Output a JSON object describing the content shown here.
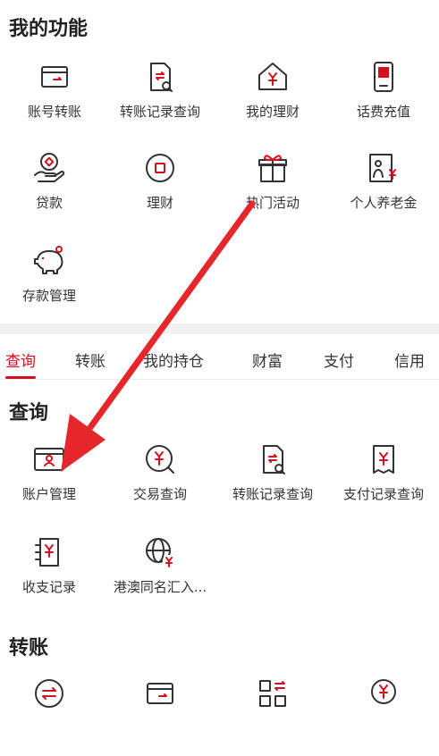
{
  "my_functions": {
    "title": "我的功能",
    "items": [
      {
        "label": "账号转账",
        "icon": "card-transfer-icon"
      },
      {
        "label": "转账记录查询",
        "icon": "transfer-record-search-icon"
      },
      {
        "label": "我的理财",
        "icon": "house-yen-icon"
      },
      {
        "label": "话费充值",
        "icon": "phone-recharge-icon"
      },
      {
        "label": "贷款",
        "icon": "loan-hand-icon"
      },
      {
        "label": "理财",
        "icon": "wealth-circle-icon"
      },
      {
        "label": "热门活动",
        "icon": "gift-icon"
      },
      {
        "label": "个人养老金",
        "icon": "pension-icon"
      },
      {
        "label": "存款管理",
        "icon": "piggy-bank-icon"
      }
    ]
  },
  "tabs": [
    {
      "label": "查询",
      "active": true
    },
    {
      "label": "转账"
    },
    {
      "label": "我的持仓"
    },
    {
      "label": "财富"
    },
    {
      "label": "支付"
    },
    {
      "label": "信用"
    }
  ],
  "query": {
    "title": "查询",
    "items": [
      {
        "label": "账户管理",
        "icon": "account-card-icon"
      },
      {
        "label": "交易查询",
        "icon": "yen-search-icon"
      },
      {
        "label": "转账记录查询",
        "icon": "transfer-record-search-icon"
      },
      {
        "label": "支付记录查询",
        "icon": "payment-record-icon"
      },
      {
        "label": "收支记录",
        "icon": "income-expense-icon"
      },
      {
        "label": "港澳同名汇入...",
        "icon": "globe-yen-icon"
      }
    ]
  },
  "transfer": {
    "title": "转账"
  },
  "colors": {
    "accent": "#d1121e",
    "text": "#333333",
    "divider": "#f2f2f2"
  }
}
